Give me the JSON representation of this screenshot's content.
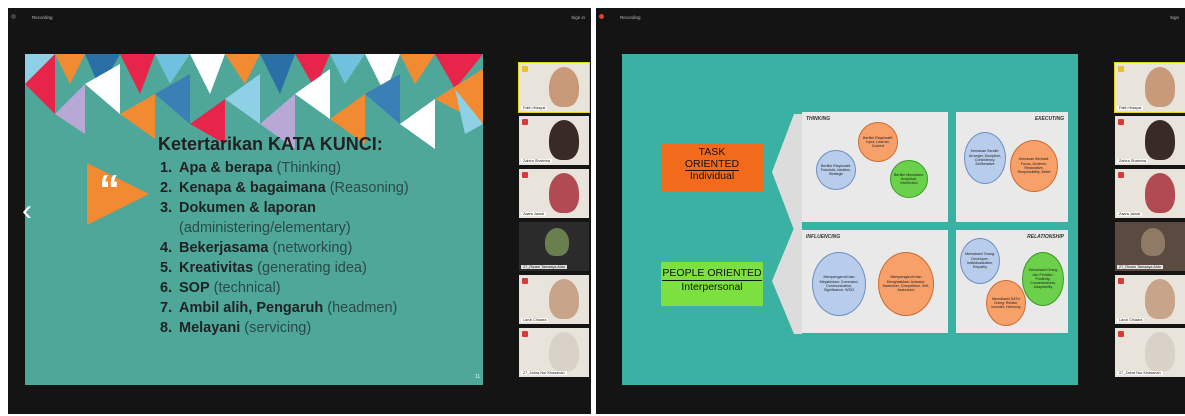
{
  "left_window": {
    "title": "Recording",
    "signin": "Sign in",
    "slide": {
      "heading": "Ketertarikan KATA KUNCI:",
      "quote_mark": "“",
      "items": [
        {
          "num": "1.",
          "key": "Apa & berapa",
          "desc": " (Thinking)",
          "desc2": ""
        },
        {
          "num": "2.",
          "key": "Kenapa & bagaimana",
          "desc": " (Reasoning)",
          "desc2": ""
        },
        {
          "num": "3.",
          "key": "Dokumen & laporan",
          "desc": "",
          "desc2": "(administering/elementary)"
        },
        {
          "num": "4.",
          "key": "Bekerjasama",
          "desc": " (networking)",
          "desc2": ""
        },
        {
          "num": "5.",
          "key": "Kreativitas",
          "desc": " (generating idea)",
          "desc2": ""
        },
        {
          "num": "6.",
          "key": "SOP",
          "desc": " (technical)",
          "desc2": ""
        },
        {
          "num": "7.",
          "key": "Ambil alih, Pengaruh",
          "desc": " (headmen)",
          "desc2": ""
        },
        {
          "num": "8.",
          "key": "Melayani",
          "desc": " (servicing)",
          "desc2": ""
        }
      ],
      "page_number": "11"
    },
    "prev_arrow": "‹",
    "participants": [
      {
        "name": "Fatih Hidayat"
      },
      {
        "name": "Zahira Shabrina"
      },
      {
        "name": "Zaara Jamal"
      },
      {
        "name": "27_Rizam Tamaaya Aldo"
      },
      {
        "name": "Lanzi Chiaara"
      },
      {
        "name": "27_Zahra Nur Khasanah"
      }
    ]
  },
  "right_window": {
    "title": "Recording",
    "signin": "Sign",
    "next_arrow": "›",
    "slide": {
      "task_line1": "TASK",
      "task_line2": "ORIENTED",
      "task_line3": "Individual",
      "people_line1": "PEOPLE ORIENTED",
      "people_line2": "Interpersonal",
      "panels": {
        "thinking": {
          "title": "THINKING",
          "c1": "Berfikir Eksploratif: Futuristic, Ideation, Strategic",
          "c2": "Berfikir Eksploratif: Input, Learner, Context",
          "c3": "Berfikir Mendalam: Analytical, Intellection"
        },
        "executing": {
          "title": "EXECUTING",
          "c1": "Kemauan Sendiri: Arranger, Discipline, Consistency, Deliberative",
          "c2": "Kemauan Berhasil: Focus, Achiever, Restorative, Responsibility, Belief"
        },
        "influencing": {
          "title": "INFLUENCING",
          "c1": "Mempengaruhi dan Meyakinkan: Command, Communication, Significance, WOO",
          "c2": "Mempengaruhi dan Menghasilkan: Activator, Maximizer, Competition, Self-Assurance"
        },
        "relationship": {
          "title": "RELATIONSHIP",
          "c1": "Memahami Orang: Developer, Individualization, Empathy",
          "c2": "Memahami SATU Orang: Relator, Includer, Harmony",
          "c3": "Memahami Orang dan Perilaku: Positivity, Connectedness, Adaptability"
        }
      }
    },
    "participants": [
      {
        "name": "Fatih Hidayat"
      },
      {
        "name": "Zahira Shabrina"
      },
      {
        "name": "Zaara Jamal"
      },
      {
        "name": "27_Rizam Tamaaya Aldo"
      },
      {
        "name": "Lanzi Chiaara"
      },
      {
        "name": "27_Zahra Nur Khasanah"
      }
    ]
  },
  "colors": {
    "left_slide_bg": "#4fa79a",
    "right_slide_bg": "#3bb1a4",
    "task_orange": "#f26b1d",
    "people_green": "#7ce040",
    "speaker_highlight": "#e6d21a"
  }
}
